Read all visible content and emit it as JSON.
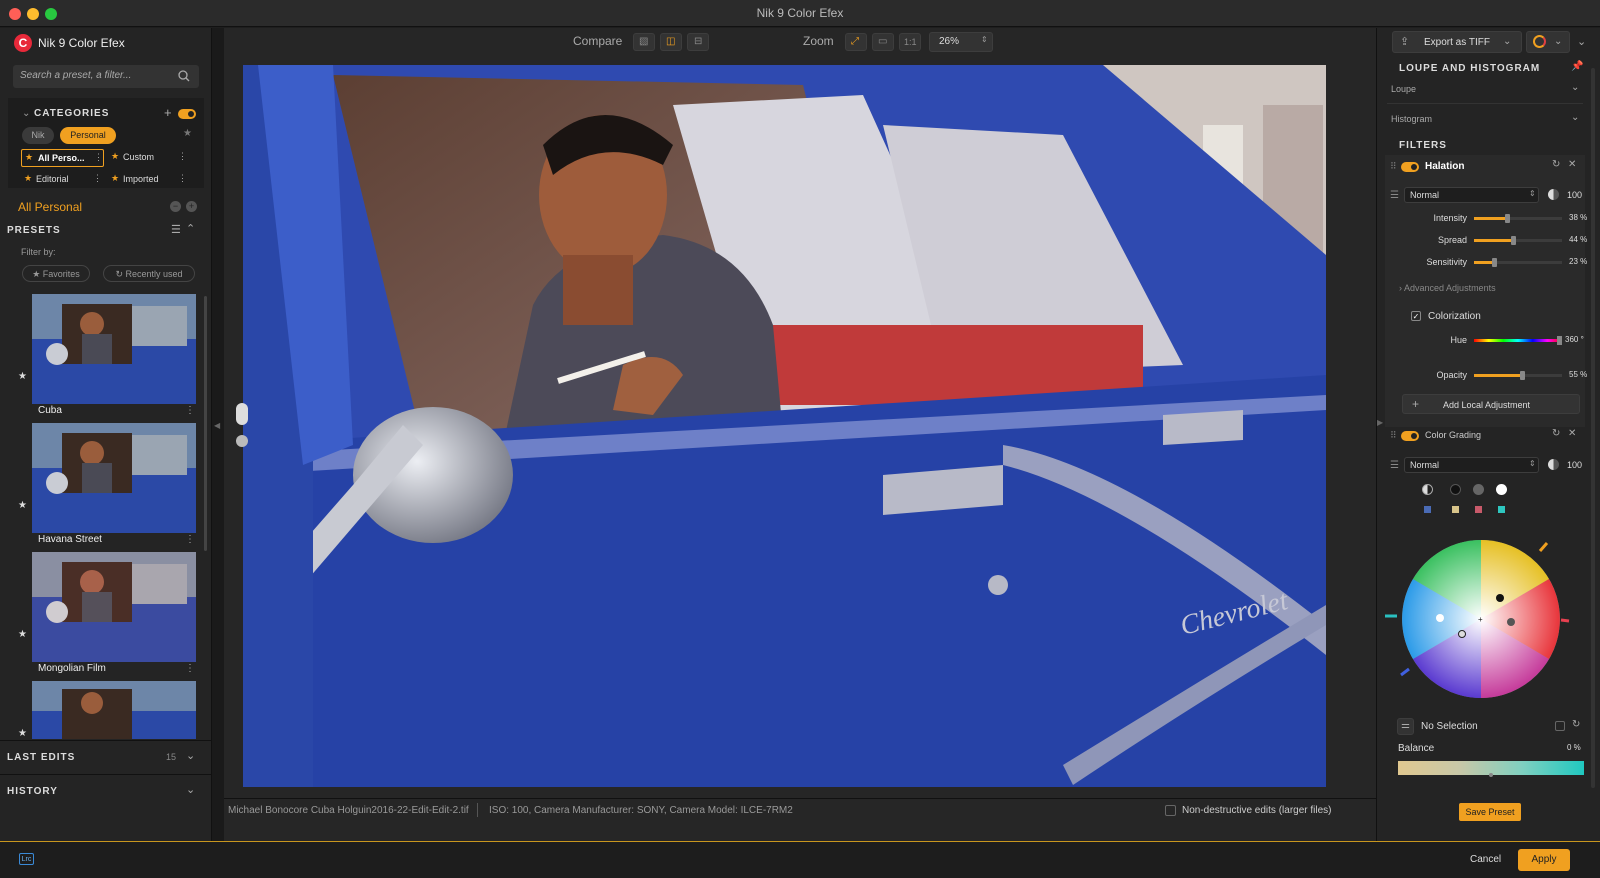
{
  "window": {
    "title": "Nik 9 Color Efex"
  },
  "app": {
    "name": "Nik 9 Color Efex"
  },
  "search": {
    "placeholder": "Search a preset, a filter..."
  },
  "categories": {
    "heading": "CATEGORIES",
    "tabs": [
      "Nik",
      "Personal"
    ],
    "items": [
      "All Perso...",
      "Custom",
      "Editorial",
      "Imported"
    ]
  },
  "current": {
    "label": "All Personal"
  },
  "presets": {
    "heading": "PRESETS",
    "filter_by": "Filter by:",
    "favorites": "Favorites",
    "recent": "Recently used",
    "items": [
      "Cuba",
      "Havana Street",
      "Mongolian Film"
    ]
  },
  "last_edits": {
    "heading": "LAST EDITS",
    "count": "15"
  },
  "history": {
    "heading": "HISTORY"
  },
  "toolbar": {
    "compare": "Compare",
    "zoom": "Zoom",
    "one_to_one": "1:1",
    "zoom_value": "26%"
  },
  "image": {
    "caption": "Michael Bonocore Cuba Holguin2016-22-Edit-Edit-2.tif",
    "meta": "ISO: 100, Camera Manufacturer: SONY, Camera Model: ILCE-7RM2",
    "non_destructive": "Non-destructive edits (larger files)"
  },
  "export": {
    "label": "Export as TIFF"
  },
  "loupe": {
    "heading": "LOUPE AND HISTOGRAM",
    "loupe": "Loupe",
    "histogram": "Histogram"
  },
  "filters": {
    "heading": "FILTERS"
  },
  "halation": {
    "name": "Halation",
    "blend": "Normal",
    "opacity": "100",
    "sliders": [
      {
        "label": "Intensity",
        "value": "38 %",
        "level": 0.38
      },
      {
        "label": "Spread",
        "value": "44 %",
        "level": 0.44
      },
      {
        "label": "Sensitivity",
        "value": "23 %",
        "level": 0.23
      }
    ],
    "advanced": "Advanced Adjustments",
    "colorization": "Colorization",
    "hue_label": "Hue",
    "hue_value": "360 °",
    "opacity_label": "Opacity",
    "opacity_value": "55 %",
    "opacity_level": 0.55,
    "add_local": "Add Local Adjustment"
  },
  "grading": {
    "name": "Color Grading",
    "blend": "Normal",
    "opacity": "100",
    "selection": "No Selection",
    "balance_label": "Balance",
    "balance_value": "0 %"
  },
  "footer": {
    "save_preset": "Save Preset",
    "cancel": "Cancel",
    "apply": "Apply",
    "lrc": "Lrc"
  },
  "colors": {
    "accent": "#f0a020",
    "car_blue": "#2f4fb5"
  }
}
